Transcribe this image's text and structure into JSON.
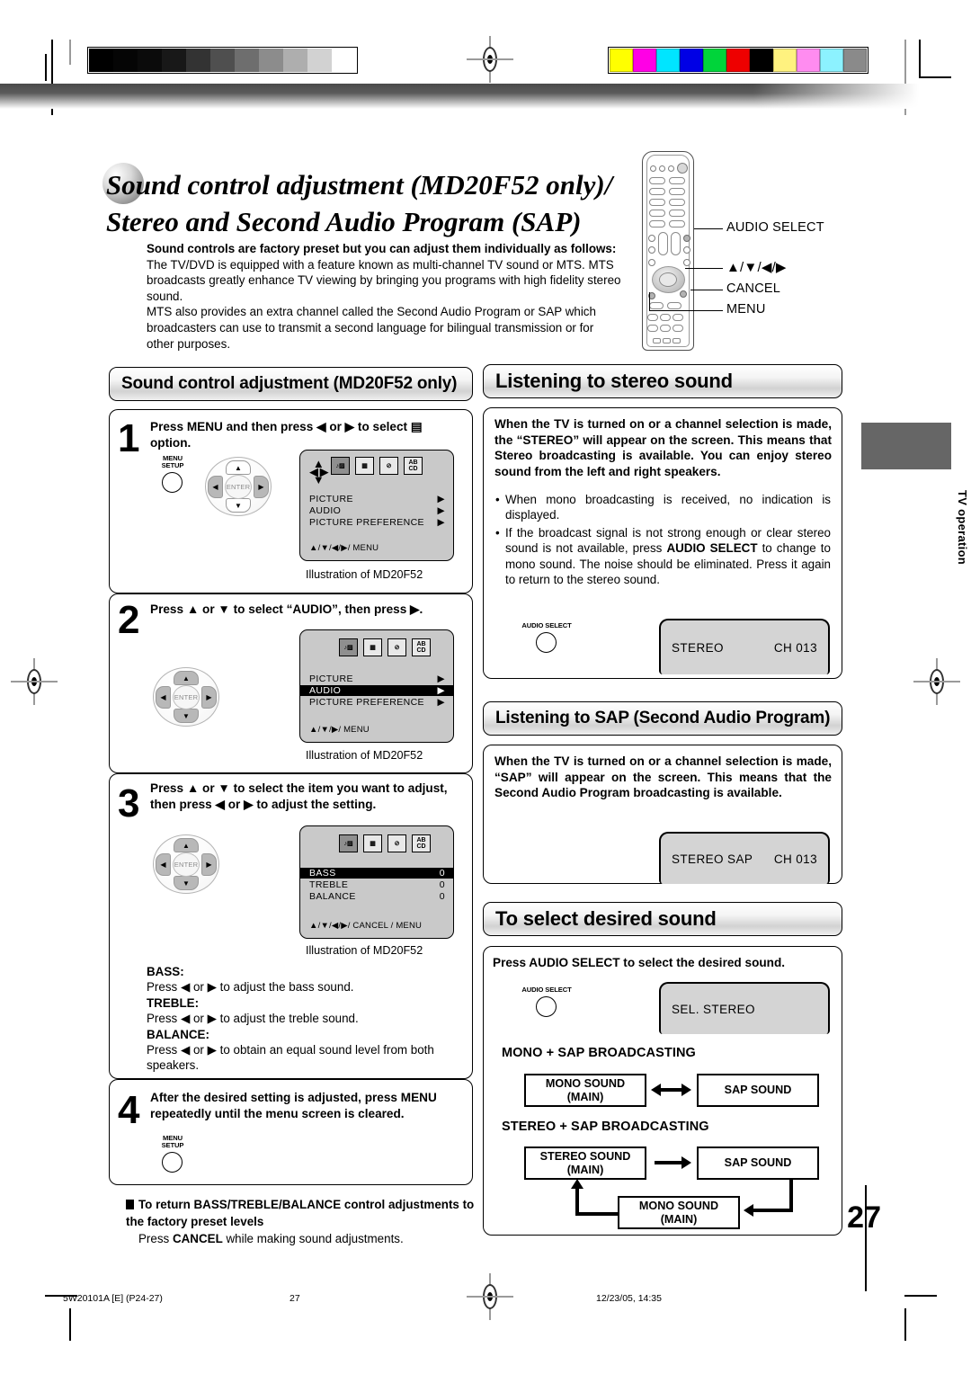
{
  "calibration": {
    "gray_swatches": [
      "#000000",
      "#050505",
      "#0b0b0b",
      "#181818",
      "#333333",
      "#4f4f4f",
      "#6e6e6e",
      "#8c8c8c",
      "#aeaeae",
      "#d2d2d2",
      "#ffffff"
    ],
    "color_swatches": [
      "#ffff00",
      "#ff00e5",
      "#00e5ff",
      "#0000e5",
      "#00d43a",
      "#ee0000",
      "#000000",
      "#fff27f",
      "#ff8cf0",
      "#8cf2ff",
      "#8a8a8a"
    ]
  },
  "title": {
    "line1": "Sound control adjustment (MD20F52 only)/",
    "line2": "Stereo and Second Audio Program (SAP)"
  },
  "intro": {
    "lead": "Sound controls are factory preset but you can adjust them individually as follows:",
    "paragraph1": "The TV/DVD is equipped with a feature known as multi-channel TV sound or MTS. MTS broadcasts greatly enhance TV viewing by bringing you programs with high fidelity stereo sound.",
    "paragraph2": "MTS also provides an extra channel called the Second Audio Program or SAP which broadcasters can use to transmit a second language for bilingual transmission or for other purposes."
  },
  "remote_callouts": {
    "audio_select": "AUDIO SELECT",
    "arrows": "▲/▼/◀/▶",
    "cancel": "CANCEL",
    "menu": "MENU"
  },
  "side_tab": {
    "label": "TV operation"
  },
  "left_column": {
    "heading": "Sound control adjustment (MD20F52 only)",
    "steps": [
      {
        "number": "1",
        "text": "Press MENU and then press ◀ or ▶ to select ▤ option.",
        "button_label_line1": "MENU",
        "button_label_line2": "SETUP",
        "pad_highlight": "lr",
        "osd": {
          "show_cursor_glyph": true,
          "icons": [
            "audio-icon",
            "grid-icon",
            "lock-icon",
            "caption-icon"
          ],
          "selected_icon_index": 0,
          "rows": [
            {
              "label": "PICTURE",
              "value": "▶",
              "highlight": false
            },
            {
              "label": "AUDIO",
              "value": "▶",
              "highlight": false
            },
            {
              "label": "PICTURE  PREFERENCE",
              "value": "▶",
              "highlight": false
            }
          ],
          "footer": "▲/▼/◀/▶/ MENU"
        },
        "caption": "Illustration of MD20F52"
      },
      {
        "number": "2",
        "text": "Press ▲ or ▼ to select “AUDIO”, then press ▶.",
        "pad_highlight": "udlr",
        "osd": {
          "show_cursor_glyph": false,
          "icons": [
            "audio-icon",
            "grid-icon",
            "lock-icon",
            "caption-icon"
          ],
          "selected_icon_index": 0,
          "rows": [
            {
              "label": "PICTURE",
              "value": "▶",
              "highlight": false
            },
            {
              "label": "AUDIO",
              "value": "▶",
              "highlight": true
            },
            {
              "label": "PICTURE  PREFERENCE",
              "value": "▶",
              "highlight": false
            }
          ],
          "footer": "▲/▼/▶/ MENU"
        },
        "caption": "Illustration of MD20F52"
      },
      {
        "number": "3",
        "text": "Press ▲ or ▼ to select the item you want to adjust, then press ◀ or ▶ to adjust the setting.",
        "pad_highlight": "udlr",
        "osd": {
          "show_cursor_glyph": false,
          "icons": [
            "audio-icon",
            "grid-icon",
            "lock-icon",
            "caption-icon"
          ],
          "selected_icon_index": 0,
          "rows": [
            {
              "label": "BASS",
              "value": "0",
              "highlight": true
            },
            {
              "label": "TREBLE",
              "value": "0",
              "highlight": false
            },
            {
              "label": "BALANCE",
              "value": "0",
              "highlight": false
            }
          ],
          "footer": "▲/▼/◀/▶/ CANCEL / MENU"
        },
        "caption": "Illustration of MD20F52"
      },
      {
        "number": "4",
        "text": "After the desired setting is adjusted, press MENU repeatedly until the menu screen is cleared.",
        "button_label_line1": "MENU",
        "button_label_line2": "SETUP"
      }
    ],
    "definitions": [
      {
        "term": "BASS:",
        "desc": "Press ◀ or ▶ to adjust the bass sound."
      },
      {
        "term": "TREBLE:",
        "desc": "Press ◀ or ▶ to adjust the treble sound."
      },
      {
        "term": "BALANCE:",
        "desc": "Press ◀ or ▶ to obtain an equal sound level from both speakers."
      }
    ],
    "note": {
      "heading": "To return BASS/TREBLE/BALANCE control adjustments to the factory preset levels",
      "body_pre": "Press ",
      "body_bold": "CANCEL",
      "body_post": " while making sound adjustments."
    }
  },
  "right_column": {
    "stereo": {
      "heading": "Listening to stereo sound",
      "lead": "When the TV is turned on or a channel selection is made, the “STEREO” will appear on the screen. This means that Stereo broadcasting is available. You can enjoy stereo sound from the left and right speakers.",
      "bullets": [
        "When mono broadcasting is received, no indication is displayed.",
        "If the broadcast signal is not strong enough or clear stereo sound is not available, press AUDIO SELECT to change to mono sound. The noise should be eliminated. Press it again to return to the stereo sound."
      ],
      "bullet2_bold": "AUDIO SELECT",
      "button_label": "AUDIO SELECT",
      "tv_display_left": "STEREO",
      "tv_display_right": "CH 013"
    },
    "sap": {
      "heading": "Listening to SAP (Second Audio Program)",
      "lead": "When the TV is turned on or a channel selection is made, “SAP” will appear on the screen. This means that the Second Audio Program broadcasting is available.",
      "tv_display_left": "STEREO  SAP",
      "tv_display_right": "CH 013"
    },
    "select_sound": {
      "heading": "To select desired sound",
      "lead": "Press AUDIO SELECT to select the desired sound.",
      "button_label": "AUDIO SELECT",
      "tv_display": "SEL. STEREO",
      "diagram1": {
        "title": "MONO + SAP BROADCASTING",
        "left_box_line1": "MONO SOUND",
        "left_box_line2": "(MAIN)",
        "right_box_line1": "SAP SOUND",
        "arrow": "bidirectional"
      },
      "diagram2": {
        "title": "STEREO + SAP BROADCASTING",
        "box1_line1": "STEREO SOUND",
        "box1_line2": "(MAIN)",
        "box2_line1": "SAP SOUND",
        "box3_line1": "MONO SOUND",
        "box3_line2": "(MAIN)",
        "arrow": "cycle"
      }
    }
  },
  "page": {
    "number": "27",
    "footer_left": "5W20101A [E] (P24-27)",
    "footer_center": "27",
    "footer_right": "12/23/05, 14:35"
  }
}
